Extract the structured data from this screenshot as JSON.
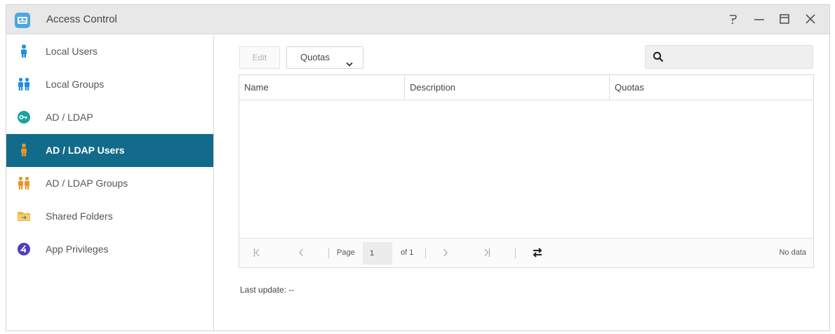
{
  "window": {
    "title": "Access Control",
    "controls": [
      "help-icon",
      "minimize-icon",
      "maximize-icon",
      "close-icon"
    ]
  },
  "sidebar": {
    "items": [
      {
        "label": "Local Users",
        "icon": "user-icon",
        "active": false
      },
      {
        "label": "Local Groups",
        "icon": "users-icon",
        "active": false
      },
      {
        "label": "AD / LDAP",
        "icon": "ldap-key-icon",
        "active": false
      },
      {
        "label": "AD / LDAP Users",
        "icon": "user-icon",
        "active": true
      },
      {
        "label": "AD / LDAP Groups",
        "icon": "users-icon",
        "active": false
      },
      {
        "label": "Shared Folders",
        "icon": "folder-icon",
        "active": false
      },
      {
        "label": "App Privileges",
        "icon": "app-privileges-icon",
        "active": false
      }
    ]
  },
  "toolbar": {
    "edit_label": "Edit",
    "quotas_label": "Quotas",
    "search_placeholder": ""
  },
  "table": {
    "columns": [
      "Name",
      "Description",
      "Quotas"
    ],
    "rows": []
  },
  "pager": {
    "page_label": "Page",
    "page_value": "1",
    "of_label": "of 1",
    "status": "No data"
  },
  "footer": {
    "last_update": "Last update: --"
  },
  "colors": {
    "accent": "#126b8a",
    "titlebar": "#e8e8e8",
    "user_blue": "#1b8fe0",
    "ldap_orange": "#e8952a"
  }
}
